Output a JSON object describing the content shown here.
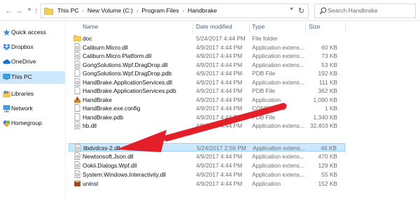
{
  "address_bar": {
    "breadcrumbs": [
      "This PC",
      "New Volume (C:)",
      "Program Files",
      "Handbrake"
    ]
  },
  "search": {
    "placeholder": "Search Handbrake"
  },
  "sidebar": {
    "items": [
      {
        "label": "Quick access",
        "icon": "star-icon"
      },
      {
        "label": "Dropbox",
        "icon": "dropbox-icon"
      },
      {
        "label": "OneDrive",
        "icon": "cloud-icon"
      },
      {
        "label": "This PC",
        "icon": "computer-icon",
        "selected": true
      },
      {
        "label": "Libraries",
        "icon": "libraries-icon"
      },
      {
        "label": "Network",
        "icon": "network-icon"
      },
      {
        "label": "Homegroup",
        "icon": "homegroup-icon"
      }
    ]
  },
  "columns": {
    "name": "Name",
    "date": "Date modified",
    "type": "Type",
    "size": "Size"
  },
  "files": [
    {
      "name": "doc",
      "date": "5/24/2017 4:44 PM",
      "type": "File folder",
      "size": "",
      "icon": "folder-icon"
    },
    {
      "name": "Caliburn.Micro.dll",
      "date": "4/9/2017 4:44 PM",
      "type": "Application extens...",
      "size": "60 KB",
      "icon": "dll-icon"
    },
    {
      "name": "Caliburn.Micro.Platform.dll",
      "date": "4/9/2017 4:44 PM",
      "type": "Application extens...",
      "size": "73 KB",
      "icon": "dll-icon"
    },
    {
      "name": "GongSolutions.Wpf.DragDrop.dll",
      "date": "4/9/2017 4:44 PM",
      "type": "Application extens...",
      "size": "53 KB",
      "icon": "dll-icon"
    },
    {
      "name": "GongSolutions.Wpf.DragDrop.pdb",
      "date": "4/9/2017 4:44 PM",
      "type": "PDB File",
      "size": "192 KB",
      "icon": "file-icon"
    },
    {
      "name": "HandBrake.ApplicationServices.dll",
      "date": "4/9/2017 4:44 PM",
      "type": "Application extens...",
      "size": "111 KB",
      "icon": "dll-icon"
    },
    {
      "name": "HandBrake.ApplicationServices.pdb",
      "date": "4/9/2017 4:44 PM",
      "type": "PDB File",
      "size": "362 KB",
      "icon": "file-icon"
    },
    {
      "name": "HandBrake",
      "date": "4/9/2017 4:44 PM",
      "type": "Application",
      "size": "1,090 KB",
      "icon": "handbrake-icon"
    },
    {
      "name": "HandBrake.exe.config",
      "date": "4/9/2017 4:44 PM",
      "type": "CONFIG File",
      "size": "1 KB",
      "icon": "file-icon"
    },
    {
      "name": "HandBrake.pdb",
      "date": "4/9/2017 4:44 PM",
      "type": "PDB File",
      "size": "1,340 KB",
      "icon": "file-icon"
    },
    {
      "name": "hb.dll",
      "date": "4/9/2017 4:44 PM",
      "type": "Application extens...",
      "size": "32,403 KB",
      "icon": "dll-icon"
    },
    {
      "name": "libdvdcss-2.dll",
      "date": "5/24/2017 2:56 PM",
      "type": "Application extens...",
      "size": "46 KB",
      "icon": "dll-icon",
      "selected": true
    },
    {
      "name": "Newtonsoft.Json.dll",
      "date": "4/9/2017 4:44 PM",
      "type": "Application extens...",
      "size": "470 KB",
      "icon": "dll-icon"
    },
    {
      "name": "Ookii.Dialogs.Wpf.dll",
      "date": "4/9/2017 4:44 PM",
      "type": "Application extens...",
      "size": "129 KB",
      "icon": "dll-icon"
    },
    {
      "name": "System.Windows.Interactivity.dll",
      "date": "4/9/2017 4:44 PM",
      "type": "Application extens...",
      "size": "55 KB",
      "icon": "dll-icon"
    },
    {
      "name": "uninst",
      "date": "4/9/2017 4:44 PM",
      "type": "Application",
      "size": "152 KB",
      "icon": "uninstaller-icon"
    }
  ],
  "colors": {
    "selection": "#cce8ff",
    "selection_border": "#99d1ff",
    "arrow": "#e3202a",
    "folder": "#f6cf57"
  }
}
